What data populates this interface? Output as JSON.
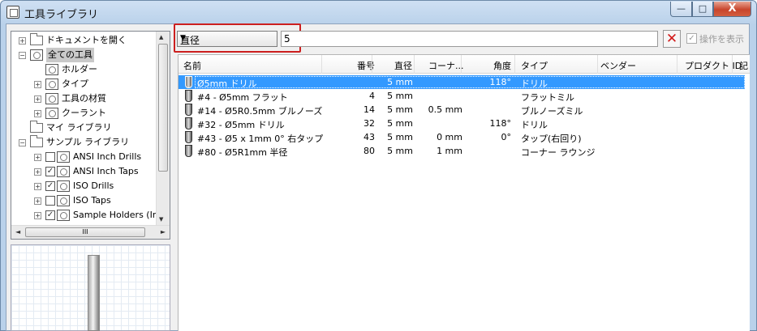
{
  "window": {
    "title": "工具ライブラリ",
    "min_glyph": "—",
    "max_glyph": "□",
    "close_glyph": "X"
  },
  "tree": {
    "items": [
      {
        "label": "ドキュメントを開く",
        "indent": 0,
        "expander": "+",
        "icon": "open-folder-icon"
      },
      {
        "label": "全ての工具",
        "indent": 0,
        "expander": "−",
        "icon": "library-icon",
        "selected": true
      },
      {
        "label": "ホルダー",
        "indent": 1,
        "expander": "",
        "icon": "library-icon"
      },
      {
        "label": "タイプ",
        "indent": 1,
        "expander": "+",
        "icon": "library-icon"
      },
      {
        "label": "工具の材質",
        "indent": 1,
        "expander": "+",
        "icon": "library-icon"
      },
      {
        "label": "クーラント",
        "indent": 1,
        "expander": "+",
        "icon": "library-icon"
      },
      {
        "label": "マイ ライブラリ",
        "indent": 0,
        "expander": "",
        "icon": "folder-icon"
      },
      {
        "label": "サンプル ライブラリ",
        "indent": 0,
        "expander": "−",
        "icon": "folder-icon"
      },
      {
        "label": "ANSI Inch Drills",
        "indent": 1,
        "expander": "+",
        "icon": "checkbox-icon",
        "checked": false
      },
      {
        "label": "ANSI Inch Taps",
        "indent": 1,
        "expander": "+",
        "icon": "checkbox-icon",
        "checked": true
      },
      {
        "label": "ISO Drills",
        "indent": 1,
        "expander": "+",
        "icon": "checkbox-icon",
        "checked": true
      },
      {
        "label": "ISO Taps",
        "indent": 1,
        "expander": "+",
        "icon": "checkbox-icon",
        "checked": false
      },
      {
        "label": "Sample Holders (Inch)",
        "indent": 1,
        "expander": "+",
        "icon": "checkbox-icon",
        "checked": true
      }
    ],
    "hscroll_grip": "III"
  },
  "filter": {
    "field": "直径",
    "value": "5",
    "show_operations_label": "操作を表示"
  },
  "table": {
    "columns": [
      "名前",
      "番号",
      "直径",
      "コーナ...",
      "角度",
      "タイプ",
      "ベンダー",
      "プロダクト ID",
      "記"
    ],
    "rows": [
      {
        "name": "Ø5mm ドリル",
        "number": "",
        "diameter": "5 mm",
        "corner": "",
        "angle": "118°",
        "type": "ドリル",
        "selected": true
      },
      {
        "name": "#4 - Ø5mm フラット",
        "number": "4",
        "diameter": "5 mm",
        "corner": "",
        "angle": "",
        "type": "フラットミル"
      },
      {
        "name": "#14 - Ø5R0.5mm ブルノーズ",
        "number": "14",
        "diameter": "5 mm",
        "corner": "0.5 mm",
        "angle": "",
        "type": "ブルノーズミル"
      },
      {
        "name": "#32 - Ø5mm ドリル",
        "number": "32",
        "diameter": "5 mm",
        "corner": "",
        "angle": "118°",
        "type": "ドリル"
      },
      {
        "name": "#43 - Ø5 x 1mm 0° 右タップ",
        "number": "43",
        "diameter": "5 mm",
        "corner": "0 mm",
        "angle": "0°",
        "type": "タップ(右回り)"
      },
      {
        "name": "#80 - Ø5R1mm 半径",
        "number": "80",
        "diameter": "5 mm",
        "corner": "1 mm",
        "angle": "",
        "type": "コーナー ラウンジ"
      }
    ]
  },
  "colors": {
    "selection": "#3399ff",
    "filter_highlight": "#cc1f1f",
    "clear_icon": "#d21a1a"
  }
}
